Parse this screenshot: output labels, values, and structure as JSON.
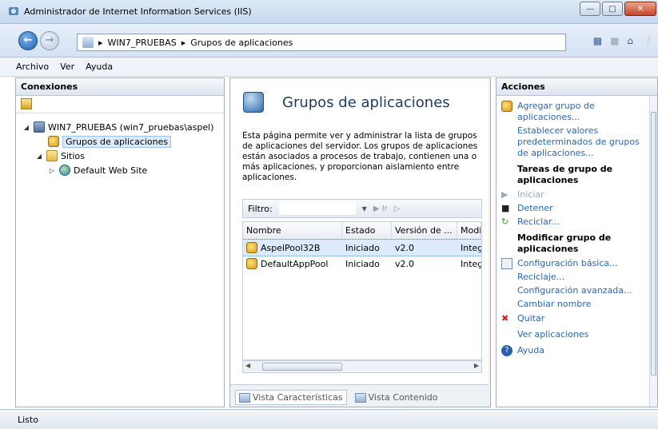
{
  "window": {
    "title": "Administrador de Internet Information Services (IIS)"
  },
  "address": {
    "segments": [
      "WIN7_PRUEBAS",
      "Grupos de aplicaciones"
    ]
  },
  "menu": [
    "Archivo",
    "Ver",
    "Ayuda"
  ],
  "connections": {
    "header": "Conexiones",
    "tree": [
      {
        "label": "WIN7_PRUEBAS (win7_pruebas\\aspel)",
        "icon": "server-icon"
      },
      {
        "label": "Grupos de aplicaciones",
        "icon": "app-pool-icon",
        "selected": true
      },
      {
        "label": "Sitios",
        "icon": "folder-icon"
      },
      {
        "label": "Default Web Site",
        "icon": "globe-icon"
      }
    ]
  },
  "main": {
    "title": "Grupos de aplicaciones",
    "description": "Esta página permite ver y administrar la lista de grupos de aplicaciones del servidor. Los grupos de aplicaciones están asociados a procesos de trabajo, contienen una o más aplicaciones, y proporcionan aislamiento entre aplicaciones.",
    "filter_label": "Filtro:",
    "columns": [
      "Nombre",
      "Estado",
      "Versión de ...",
      "Modi"
    ],
    "rows": [
      {
        "name": "AspelPool32B",
        "state": "Iniciado",
        "version": "v2.0",
        "mode": "Integ",
        "selected": true
      },
      {
        "name": "DefaultAppPool",
        "state": "Iniciado",
        "version": "v2.0",
        "mode": "Integ",
        "selected": false
      }
    ],
    "tabs": [
      "Vista Características",
      "Vista Contenido"
    ]
  },
  "actions": {
    "header": "Acciones",
    "add_pool": "Agregar grupo de aplicaciones...",
    "set_defaults": "Establecer valores predeterminados de grupos de aplicaciones...",
    "task_header": "Tareas de grupo de aplicaciones",
    "start": "Iniciar",
    "stop": "Detener",
    "recycle": "Reciclar...",
    "modify_header": "Modificar grupo de aplicaciones",
    "basic_config": "Configuración básica...",
    "recycling": "Reciclaje...",
    "advanced_config": "Configuración avanzada...",
    "rename": "Cambiar nombre",
    "remove": "Quitar",
    "view_apps": "Ver aplicaciones",
    "help": "Ayuda"
  },
  "status": "Listo"
}
